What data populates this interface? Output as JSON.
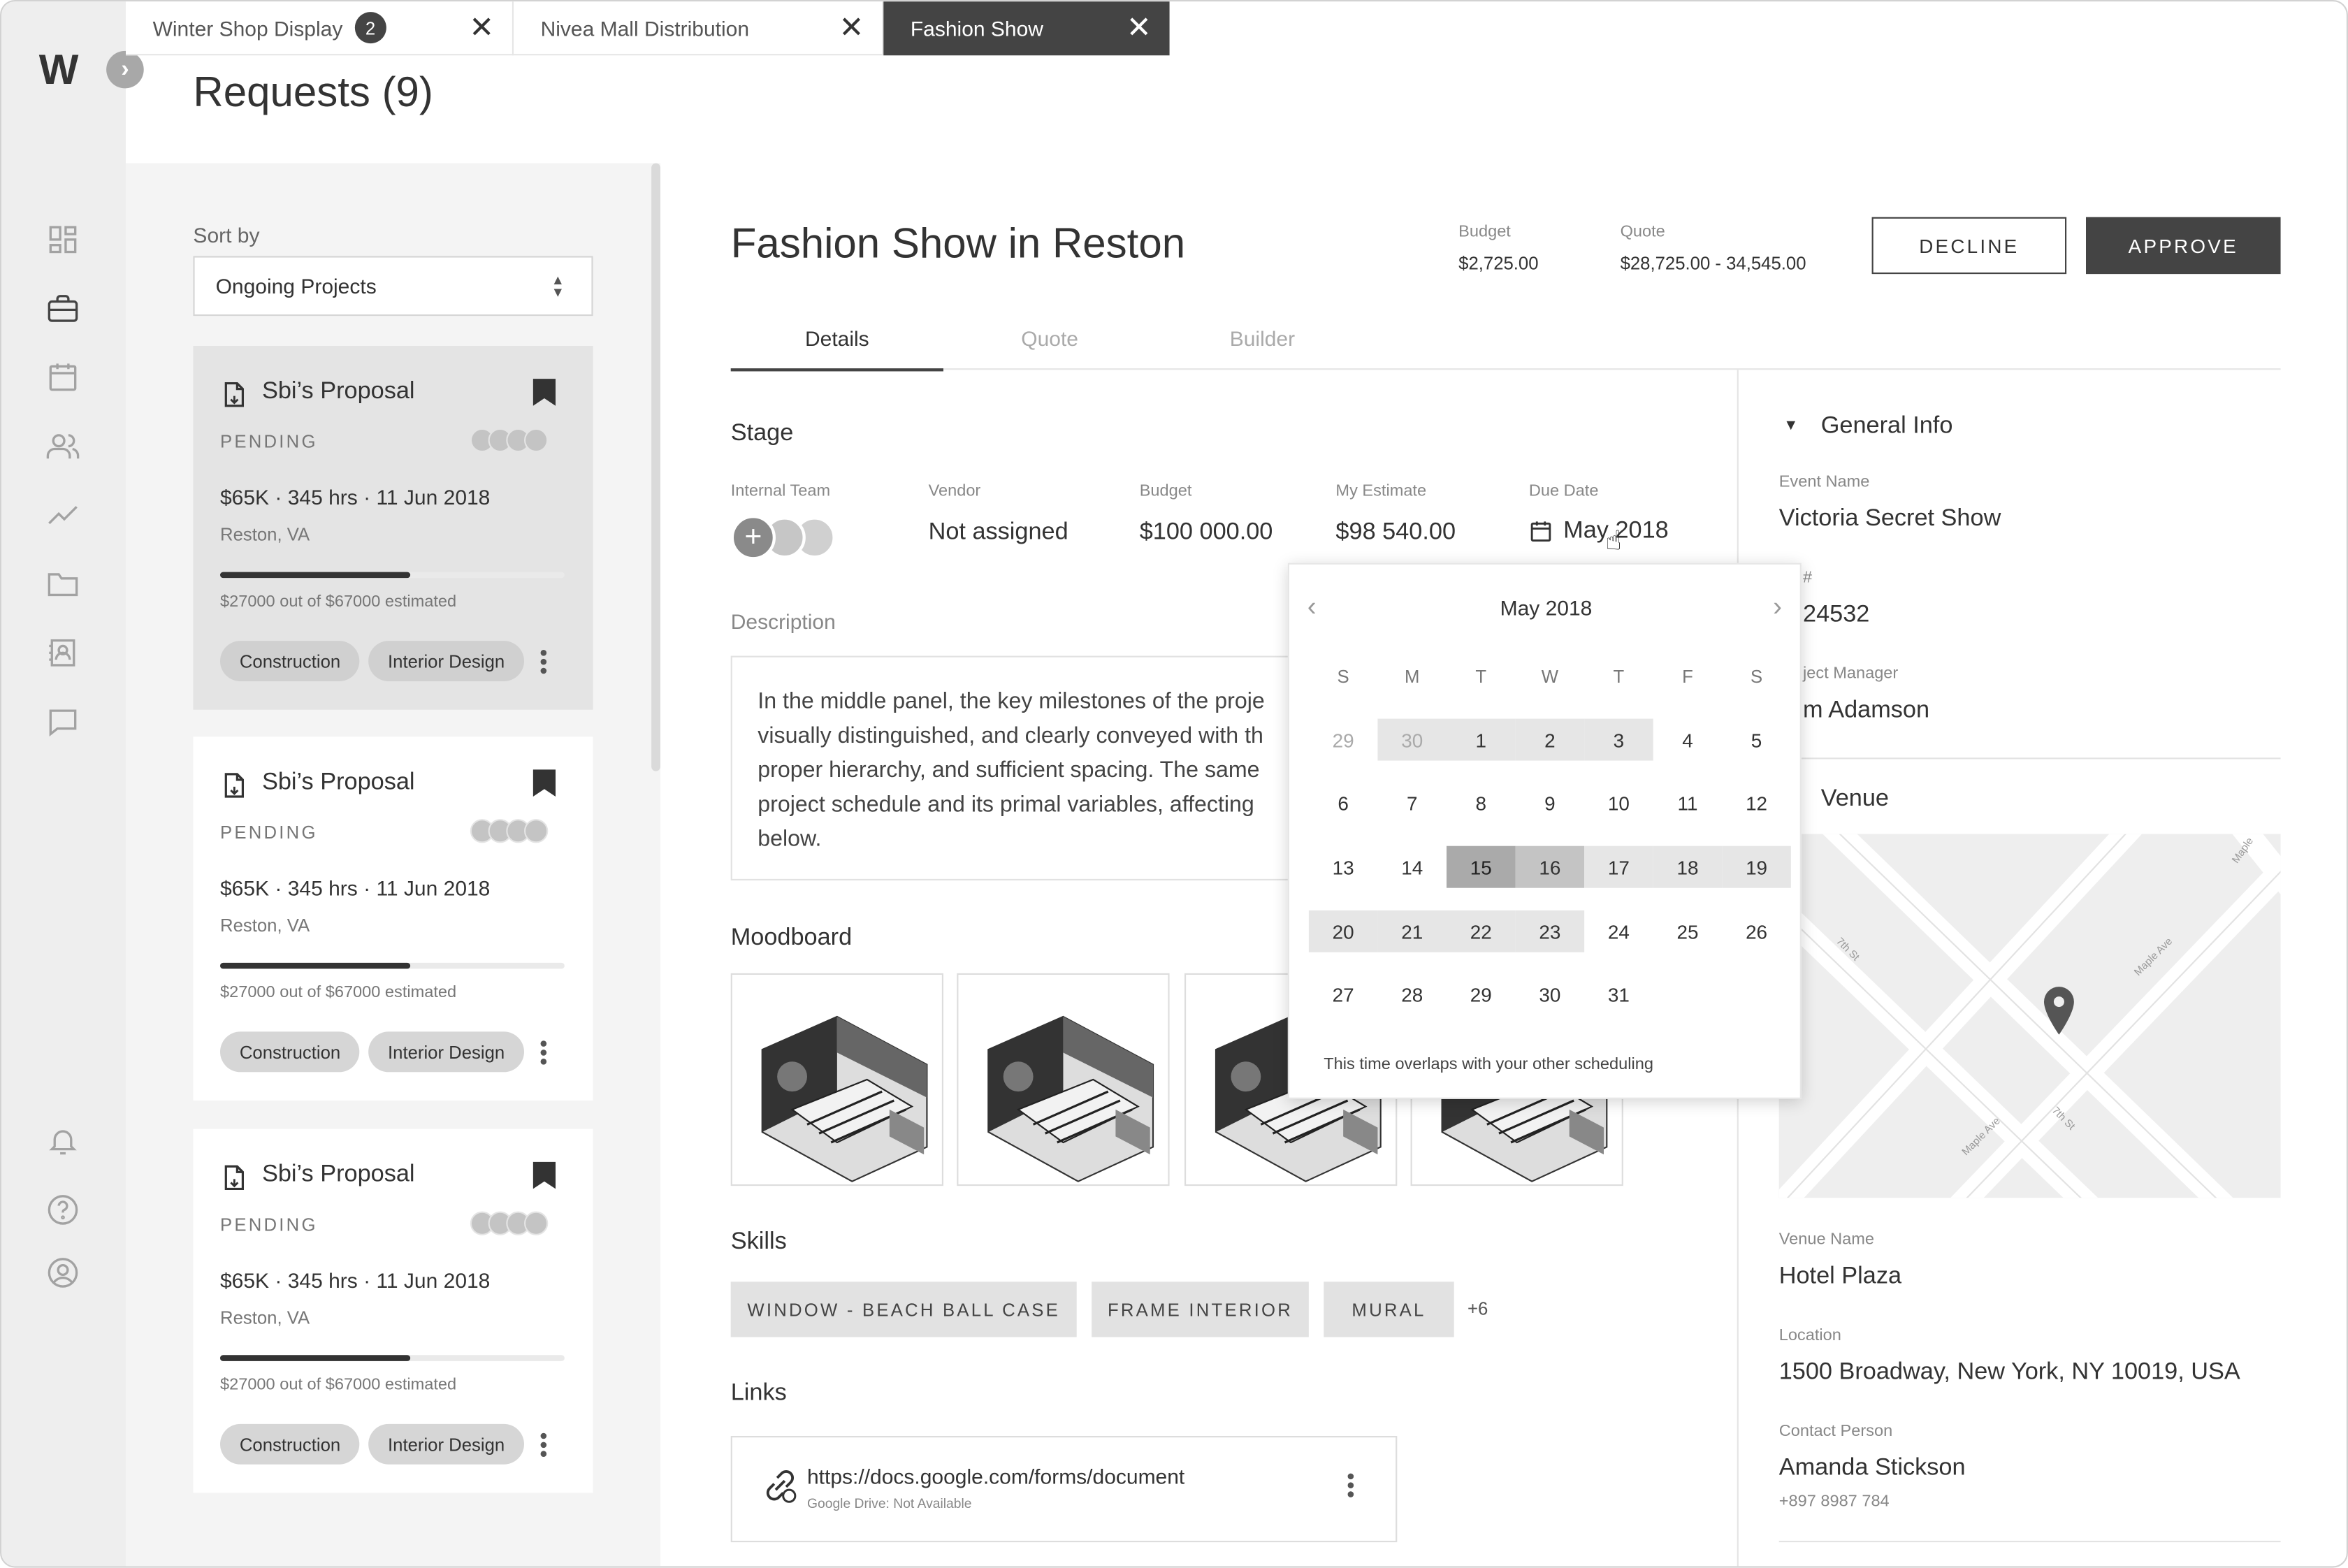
{
  "app": {
    "logo": "W",
    "page_title": "Requests (9)"
  },
  "tabs": [
    {
      "label": "Winter Shop Display",
      "badge": "2"
    },
    {
      "label": "Nivea Mall Distribution"
    },
    {
      "label": "Fashion Show"
    }
  ],
  "list": {
    "sort_label": "Sort by",
    "sort_value": "Ongoing Projects",
    "cards": [
      {
        "title": "Sbi’s Proposal",
        "status": "PENDING",
        "meta": "$65K · 345 hrs · 11 Jun 2018",
        "location": "Reston, VA",
        "progress": 0.55,
        "estimate": "$27000 out of $67000 estimated",
        "tags": [
          "Construction",
          "Interior Design"
        ]
      },
      {
        "title": "Sbi’s Proposal",
        "status": "PENDING",
        "meta": "$65K · 345 hrs · 11 Jun 2018",
        "location": "Reston, VA",
        "progress": 0.55,
        "estimate": "$27000 out of $67000 estimated",
        "tags": [
          "Construction",
          "Interior Design"
        ]
      },
      {
        "title": "Sbi’s Proposal",
        "status": "PENDING",
        "meta": "$65K · 345 hrs · 11 Jun 2018",
        "location": "Reston, VA",
        "progress": 0.55,
        "estimate": "$27000 out of $67000 estimated",
        "tags": [
          "Construction",
          "Interior Design"
        ]
      }
    ]
  },
  "detail": {
    "title": "Fashion Show in Reston",
    "budget_label": "Budget",
    "budget_value": "$2,725.00",
    "quote_label": "Quote",
    "quote_value": "$28,725.00 - 34,545.00",
    "decline": "DECLINE",
    "approve": "APPROVE",
    "tabs": [
      "Details",
      "Quote",
      "Builder"
    ],
    "stage": {
      "title": "Stage",
      "internal_team_label": "Internal Team",
      "vendor_label": "Vendor",
      "vendor_value": "Not assigned",
      "budget_label": "Budget",
      "budget_value": "$100 000.00",
      "estimate_label": "My Estimate",
      "estimate_value": "$98 540.00",
      "due_label": "Due Date",
      "due_value": "May 2018"
    },
    "description_label": "Description",
    "description_lines": [
      "In the middle panel, the key milestones of the proje",
      "visually distinguished, and clearly conveyed with th",
      "proper hierarchy, and sufficient spacing. The same",
      "project schedule and its primal variables, affecting",
      "below."
    ],
    "moodboard_label": "Moodboard",
    "skills_label": "Skills",
    "skills": [
      "WINDOW - BEACH BALL CASE",
      "FRAME INTERIOR",
      "MURAL"
    ],
    "skills_more": "+6",
    "links_label": "Links",
    "link": {
      "url": "https://docs.google.com/forms/document",
      "sub": "Google Drive: Not Available"
    }
  },
  "general_info": {
    "title": "General Info",
    "event_name_label": "Event Name",
    "event_name": "Victoria Secret Show",
    "po_label": "# ",
    "po_value": "24532",
    "pm_label": "ject Manager",
    "pm_value": "m Adamson",
    "venue_title": "Venue",
    "map_streets": [
      "7th St",
      "Maple Ave",
      "Maple Ave",
      "7th St",
      "Maple"
    ],
    "venue_name_label": "Venue Name",
    "venue_name": "Hotel Plaza",
    "location_label": "Location",
    "location": "1500 Broadway, New York, NY 10019, USA",
    "contact_label": "Contact Person",
    "contact_name": "Amanda Stickson",
    "contact_phone": "+897 8987 784"
  },
  "calendar": {
    "month": "May 2018",
    "weekdays": [
      "S",
      "M",
      "T",
      "W",
      "T",
      "F",
      "S"
    ],
    "weeks": [
      [
        "29",
        "30",
        "1",
        "2",
        "3",
        "4",
        "5"
      ],
      [
        "6",
        "7",
        "8",
        "9",
        "10",
        "11",
        "12"
      ],
      [
        "13",
        "14",
        "15",
        "16",
        "17",
        "18",
        "19"
      ],
      [
        "20",
        "21",
        "22",
        "23",
        "24",
        "25",
        "26"
      ],
      [
        "27",
        "28",
        "29",
        "30",
        "31",
        "",
        ""
      ]
    ],
    "note": "This time overlaps with your other scheduling"
  },
  "colors": {
    "accent_dark": "#444444",
    "chip": "#d6d6d6",
    "sidebar": "#eeeeee"
  },
  "icons": [
    "dashboard-icon",
    "briefcase-icon",
    "calendar-icon",
    "users-icon",
    "trending-icon",
    "folder-icon",
    "contact-icon",
    "chat-icon",
    "bell-icon",
    "help-icon",
    "profile-icon"
  ]
}
